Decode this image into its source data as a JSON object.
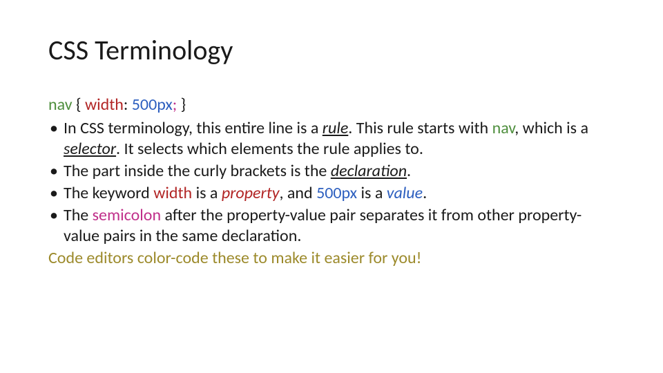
{
  "title": "CSS Terminology",
  "code": {
    "selector": "nav",
    "brace_open": " { ",
    "property": "width",
    "colon_sp": ": ",
    "value": "500px",
    "semicolon": ";",
    "brace_close": " }"
  },
  "bullets": {
    "b1": {
      "p1": "In CSS terminology, this entire line is a ",
      "rule": "rule",
      "p2": ". This rule starts with ",
      "nav": "nav",
      "p3": ", which is a ",
      "selector": "selector",
      "p4": ". It selects which elements the rule applies to."
    },
    "b2": {
      "p1": "The part inside the curly brackets is the ",
      "declaration": "declaration",
      "p2": "."
    },
    "b3": {
      "p1": "The keyword ",
      "width": "width",
      "p2": " is a ",
      "property": "property",
      "p3": ", and ",
      "value_num": "500px",
      "p4": " is a ",
      "value_word": "value",
      "p5": "."
    },
    "b4": {
      "p1": "The ",
      "semicolon": "semicolon",
      "p2": " after the property-value pair separates it from other property-value pairs in the same declaration."
    }
  },
  "closing": "Code editors color-code these to make it easier for you!"
}
